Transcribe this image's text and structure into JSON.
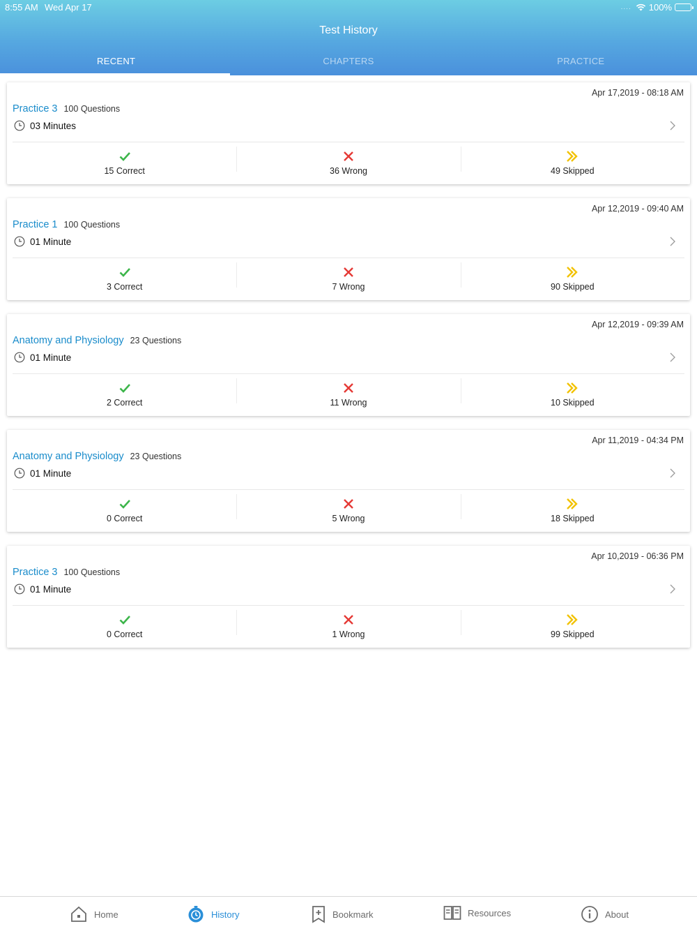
{
  "status_bar": {
    "time": "8:55 AM",
    "date": "Wed Apr 17",
    "signal": "....",
    "battery": "100%"
  },
  "header": {
    "title": "Test History"
  },
  "tabs": [
    {
      "label": "RECENT",
      "active": true
    },
    {
      "label": "CHAPTERS",
      "active": false
    },
    {
      "label": "PRACTICE",
      "active": false
    }
  ],
  "colors": {
    "accent": "#1a8ccb",
    "correct": "#3cb54a",
    "wrong": "#e53935",
    "skipped": "#f2c200",
    "nav_active": "#2a8fd8"
  },
  "cards": [
    {
      "date": "Apr 17,2019 - 08:18 AM",
      "title": "Practice 3",
      "questions": "100 Questions",
      "duration": "03 Minutes",
      "correct": "15 Correct",
      "wrong": "36 Wrong",
      "skipped": "49 Skipped"
    },
    {
      "date": "Apr 12,2019 - 09:40 AM",
      "title": "Practice 1",
      "questions": "100 Questions",
      "duration": "01 Minute",
      "correct": "3 Correct",
      "wrong": "7 Wrong",
      "skipped": "90 Skipped"
    },
    {
      "date": "Apr 12,2019 - 09:39 AM",
      "title": "Anatomy and Physiology",
      "questions": "23 Questions",
      "duration": "01 Minute",
      "correct": "2 Correct",
      "wrong": "11 Wrong",
      "skipped": "10 Skipped"
    },
    {
      "date": "Apr 11,2019 - 04:34 PM",
      "title": "Anatomy and Physiology",
      "questions": "23 Questions",
      "duration": "01 Minute",
      "correct": "0 Correct",
      "wrong": "5 Wrong",
      "skipped": "18 Skipped"
    },
    {
      "date": "Apr 10,2019 - 06:36 PM",
      "title": "Practice 3",
      "questions": "100 Questions",
      "duration": "01 Minute",
      "correct": "0 Correct",
      "wrong": "1 Wrong",
      "skipped": "99 Skipped"
    }
  ],
  "bottom_nav": [
    {
      "label": "Home",
      "icon": "home-icon"
    },
    {
      "label": "History",
      "icon": "stopwatch-icon",
      "active": true
    },
    {
      "label": "Bookmark",
      "icon": "bookmark-icon"
    },
    {
      "label": "Resources",
      "icon": "book-icon"
    },
    {
      "label": "About",
      "icon": "info-icon"
    }
  ]
}
